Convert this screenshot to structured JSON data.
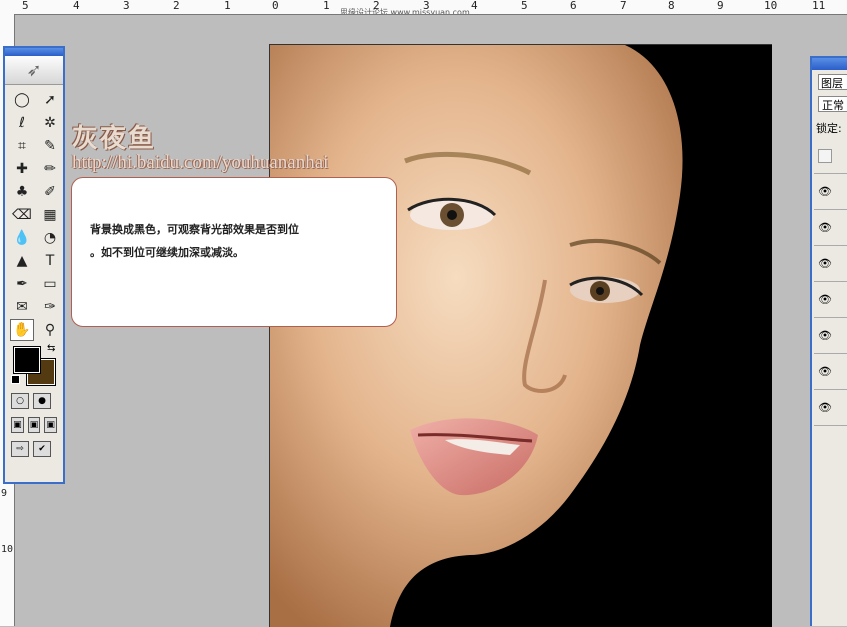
{
  "ruler_top": {
    "labels": [
      "5",
      "4",
      "3",
      "2",
      "1",
      "0",
      "1",
      "2",
      "3",
      "4",
      "5",
      "6",
      "7",
      "8",
      "9",
      "10",
      "11"
    ]
  },
  "ruler_left": {
    "labels": [
      "9",
      "10"
    ]
  },
  "watermark_top": "思缘设计论坛 www.missyuan.com",
  "brand": {
    "title": "灰夜鱼",
    "url": "http://hi.baidu.com/youhuananhai"
  },
  "callout": {
    "line1": "背景换成黑色，可观察背光部效果是否到位",
    "line2": "。如不到位可继续加深或减淡。"
  },
  "toolbox": {
    "tools": [
      {
        "name": "marquee-tool-icon",
        "glyph": "◯"
      },
      {
        "name": "move-tool-icon",
        "glyph": "➚"
      },
      {
        "name": "lasso-tool-icon",
        "glyph": "ℓ"
      },
      {
        "name": "magic-wand-tool-icon",
        "glyph": "✲"
      },
      {
        "name": "crop-tool-icon",
        "glyph": "⌗"
      },
      {
        "name": "slice-tool-icon",
        "glyph": "✎"
      },
      {
        "name": "healing-brush-tool-icon",
        "glyph": "✚"
      },
      {
        "name": "brush-tool-icon",
        "glyph": "✏"
      },
      {
        "name": "clone-stamp-tool-icon",
        "glyph": "♣"
      },
      {
        "name": "history-brush-tool-icon",
        "glyph": "✐"
      },
      {
        "name": "eraser-tool-icon",
        "glyph": "⌫"
      },
      {
        "name": "gradient-tool-icon",
        "glyph": "▦"
      },
      {
        "name": "blur-tool-icon",
        "glyph": "💧"
      },
      {
        "name": "dodge-tool-icon",
        "glyph": "◔"
      },
      {
        "name": "path-selection-tool-icon",
        "glyph": "▲"
      },
      {
        "name": "type-tool-icon",
        "glyph": "T"
      },
      {
        "name": "pen-tool-icon",
        "glyph": "✒"
      },
      {
        "name": "shape-tool-icon",
        "glyph": "▭"
      },
      {
        "name": "notes-tool-icon",
        "glyph": "✉"
      },
      {
        "name": "eyedropper-tool-icon",
        "glyph": "✑"
      },
      {
        "name": "hand-tool-icon",
        "glyph": "✋"
      },
      {
        "name": "zoom-tool-icon",
        "glyph": "⚲"
      }
    ],
    "foreground_color": "#000000",
    "background_color": "#533a10"
  },
  "layers_panel": {
    "tab_label": "图层",
    "blend_mode": "正常",
    "lock_label": "锁定:",
    "rows": [
      "",
      "eye",
      "eye",
      "eye",
      "eye",
      "eye",
      "eye",
      "eye"
    ]
  }
}
